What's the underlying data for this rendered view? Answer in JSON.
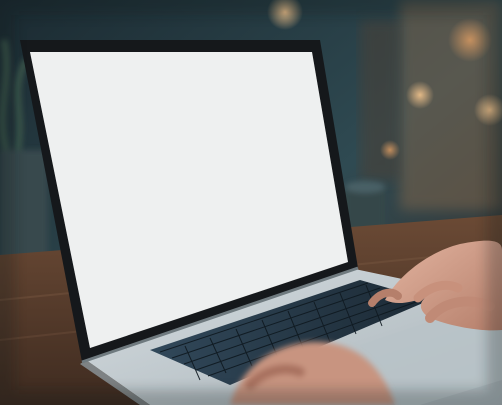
{
  "scene": {
    "subject": "laptop-with-blank-screen",
    "colors": {
      "background_dark": "#1b2a31",
      "background_teal": "#2f4a52",
      "bokeh_warm": "#e7b07a",
      "table_wood": "#6b4a35",
      "screen_blank": "#f3f4f4",
      "bezel": "#15181b",
      "laptop_body": "#c9d2d6",
      "keys": "#2a3a4a",
      "skin": "#d7a38e"
    }
  }
}
